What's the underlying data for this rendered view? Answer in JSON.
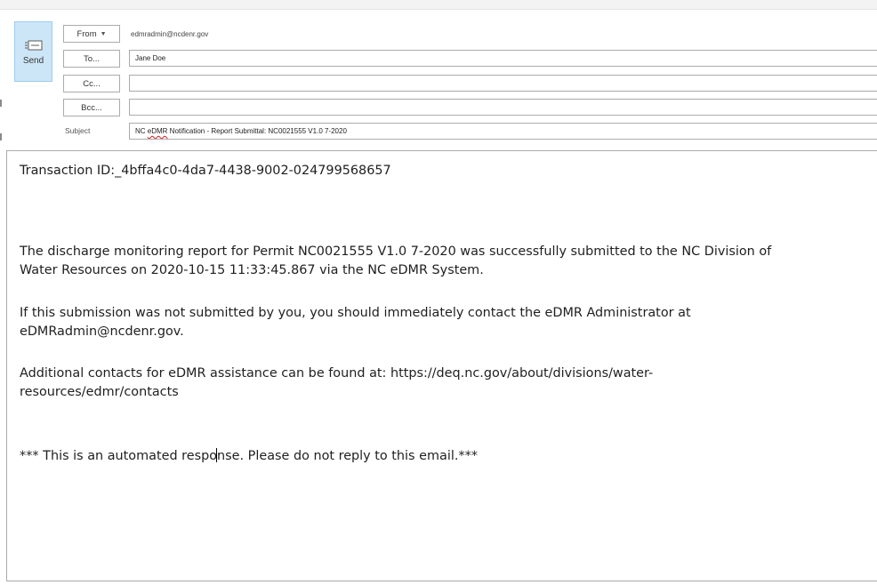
{
  "compose": {
    "send_label": "Send",
    "from_label": "From",
    "from_value": "edmradmin@ncdenr.gov",
    "to_label": "To...",
    "to_value": "Jane Doe",
    "cc_label": "Cc...",
    "cc_value": "",
    "bcc_label": "Bcc...",
    "bcc_value": "",
    "subject_label": "Subject",
    "subject_prefix": "NC ",
    "subject_misspelled": "eDMR",
    "subject_rest": " Notification - Report Submittal: NC0021555 V1.0 7-2020"
  },
  "body": {
    "transaction": "Transaction ID:_4bffa4c0-4da7-4438-9002-024799568657",
    "para1_line1": " The discharge monitoring report for Permit NC0021555 V1.0 7-2020 was successfully submitted to the NC Division of",
    "para1_line2": "Water Resources on 2020-10-15 11:33:45.867 via the NC eDMR System.",
    "para2_line1": " If this submission was not submitted by you, you should immediately contact the eDMR Administrator at",
    "para2_line2": "eDMRadmin@ncdenr.gov.",
    "para3_line1": " Additional contacts for eDMR assistance can be found at:  https://deq.nc.gov/about/divisions/water-",
    "para3_line2": "resources/edmr/contacts",
    "footer_before_caret": " *** This is an automated respo",
    "footer_after_caret": "nse. Please do not reply to this email.***"
  },
  "icons": {
    "send": "send-envelope-icon",
    "from_caret": "chevron-down-icon"
  },
  "colors": {
    "send_button_bg": "#cde6f7",
    "send_button_border": "#9ccbee",
    "spellcheck": "#d11a1a"
  }
}
